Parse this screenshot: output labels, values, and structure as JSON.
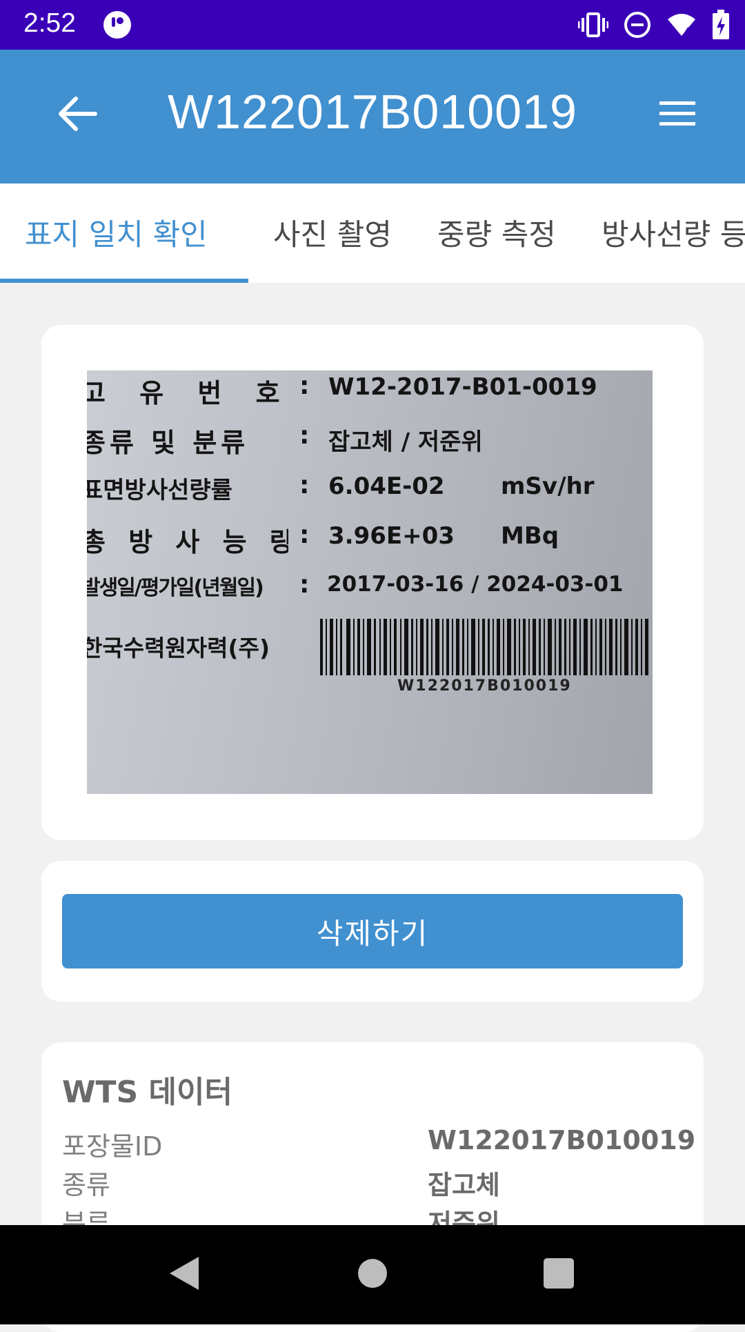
{
  "status_bar": {
    "time": "2:52",
    "icons": [
      "app-notification-icon",
      "vibrate-icon",
      "do-not-disturb-icon",
      "wifi-icon",
      "battery-charging-icon"
    ],
    "background_color": "#3a00b8"
  },
  "app_bar": {
    "title": "W122017B010019",
    "back_icon": "arrow-left-icon",
    "menu_icon": "hamburger-menu-icon",
    "background_color": "#4190d0"
  },
  "tabs": [
    {
      "label": "표지 일치 확인",
      "active": true
    },
    {
      "label": "사진 촬영",
      "active": false
    },
    {
      "label": "중량 측정",
      "active": false
    },
    {
      "label": "방사선량 등록",
      "active": false
    }
  ],
  "label_photo": {
    "rows": [
      {
        "key": "고 유 번 호",
        "colon": ":",
        "value": "W12-2017-B01-0019",
        "unit": ""
      },
      {
        "key": "종류 및 분류",
        "colon": ":",
        "value": "잡고체 / 저준위",
        "unit": ""
      },
      {
        "key": "표면방사선량률",
        "colon": ":",
        "value": "6.04E-02",
        "unit": "mSv/hr"
      },
      {
        "key": "총 방 사 능 량",
        "colon": ":",
        "value": "3.96E+03",
        "unit": "MBq"
      },
      {
        "key": "발생일/평가일(년월일)",
        "colon": ":",
        "value": "2017-03-16 / 2024-03-01",
        "unit": ""
      },
      {
        "key": "한국수력원자력(주)",
        "colon": "",
        "value": "",
        "unit": ""
      }
    ],
    "barcode_text": "W122017B010019"
  },
  "delete_button": {
    "label": "삭제하기"
  },
  "wts_data": {
    "title": "WTS 데이터",
    "rows": [
      {
        "key": "포장물ID",
        "value": "W122017B010019"
      },
      {
        "key": "종류",
        "value": "잡고체"
      },
      {
        "key": "분류",
        "value": "저준위"
      }
    ]
  },
  "nav_bar": {
    "icons": [
      "nav-back-icon",
      "nav-home-icon",
      "nav-recents-icon"
    ]
  }
}
